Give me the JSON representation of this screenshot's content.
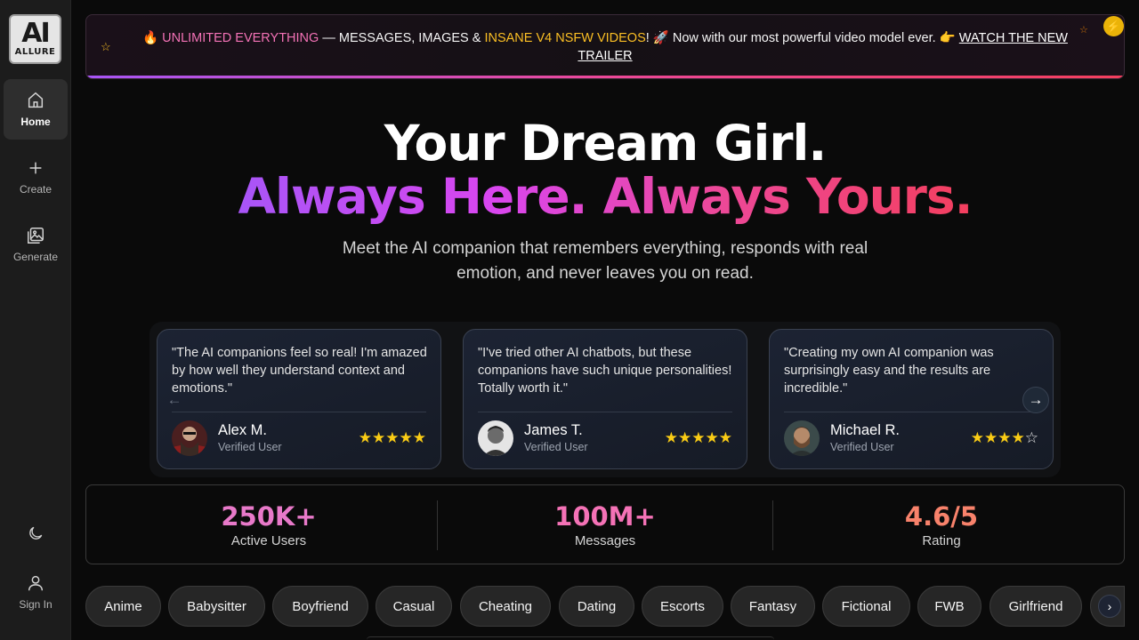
{
  "sidebar": {
    "logo_mark": "AI",
    "logo_text": "ALLURE",
    "items": [
      {
        "label": "Home",
        "icon": "home-icon"
      },
      {
        "label": "Create",
        "icon": "plus-icon"
      },
      {
        "label": "Generate",
        "icon": "image-gallery-icon"
      }
    ],
    "theme_icon": "moon-icon",
    "signin_label": "Sign In"
  },
  "banner": {
    "fire": "🔥",
    "highlight1": "UNLIMITED EVERYTHING",
    "text1": " — MESSAGES, IMAGES & ",
    "highlight2": "INSANE V4 NSFW VIDEOS",
    "text2": "! 🚀 Now with our most powerful video model ever. 👉 ",
    "link": "WATCH THE NEW TRAILER",
    "bolt": "⚡"
  },
  "hero": {
    "title_line1": "Your Dream Girl.",
    "title_line2": "Always Here. Always Yours.",
    "subtitle": "Meet the AI companion that remembers everything, responds with real emotion, and never leaves you on read."
  },
  "testimonials": [
    {
      "quote": "\"The AI companions feel so real! I'm amazed by how well they understand context and emotions.\"",
      "name": "Alex M.",
      "role": "Verified User",
      "rating": 5
    },
    {
      "quote": "\"I've tried other AI chatbots, but these companions have such unique personalities! Totally worth it.\"",
      "name": "James T.",
      "role": "Verified User",
      "rating": 5
    },
    {
      "quote": "\"Creating my own AI companion was surprisingly easy and the results are incredible.\"",
      "name": "Michael R.",
      "role": "Verified User",
      "rating": 4
    }
  ],
  "stats": [
    {
      "value": "250K+",
      "label": "Active Users"
    },
    {
      "value": "100M+",
      "label": "Messages"
    },
    {
      "value": "4.6/5",
      "label": "Rating"
    }
  ],
  "categories": [
    "Anime",
    "Babysitter",
    "Boyfriend",
    "Casual",
    "Cheating",
    "Dating",
    "Escorts",
    "Fantasy",
    "Fictional",
    "FWB",
    "Girlfriend"
  ],
  "colors": {
    "accent_purple": "#a855f7",
    "accent_pink": "#ec4899",
    "accent_red": "#f43f5e",
    "star_gold": "#facc15"
  }
}
